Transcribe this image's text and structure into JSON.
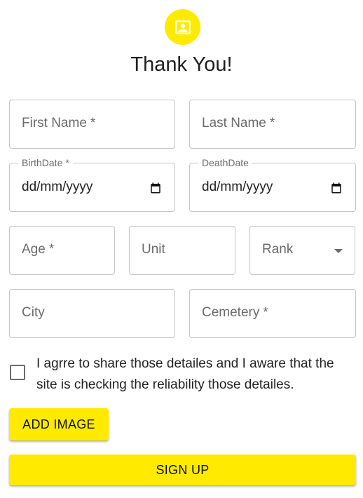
{
  "header": {
    "icon": "contact-card-icon",
    "title": "Thank You!"
  },
  "form": {
    "first_name": {
      "label": "First Name",
      "required": "*"
    },
    "last_name": {
      "label": "Last Name",
      "required": "*"
    },
    "birth_date": {
      "label": "BirthDate",
      "required": "*",
      "value": "dd/mm/yyyy"
    },
    "death_date": {
      "label": "DeathDate",
      "value": "dd/mm/yyyy"
    },
    "age": {
      "label": "Age",
      "required": "*"
    },
    "unit": {
      "label": "Unit"
    },
    "rank": {
      "label": "Rank"
    },
    "city": {
      "label": "City"
    },
    "cemetery": {
      "label": "Cemetery",
      "required": "*"
    },
    "agree_text": "I agrre to share those detailes and I aware that the site is checking the reliability those detailes."
  },
  "buttons": {
    "add_image": "ADD IMAGE",
    "sign_up": "SIGN UP"
  },
  "colors": {
    "accent": "#ffea00",
    "border": "#c4c4c4",
    "label": "#6b6b6b"
  }
}
